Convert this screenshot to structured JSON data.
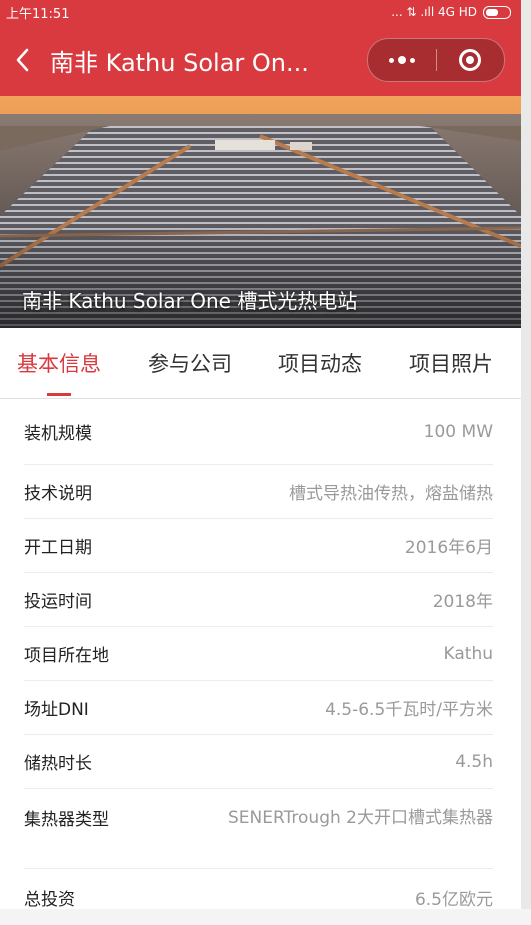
{
  "status_bar": {
    "time": "上午11:51",
    "network": "... ⇅ .ıll 4G HD"
  },
  "nav": {
    "title": "南非 Kathu Solar On...",
    "back_icon": "chevron-left-icon",
    "more_icon": "more-dots-icon",
    "close_icon": "target-circle-icon"
  },
  "hero": {
    "caption": "南非 Kathu Solar One 槽式光热电站"
  },
  "tabs": [
    {
      "label": "基本信息",
      "active": true
    },
    {
      "label": "参与公司",
      "active": false
    },
    {
      "label": "项目动态",
      "active": false
    },
    {
      "label": "项目照片",
      "active": false
    }
  ],
  "info_rows": [
    {
      "label": "装机规模",
      "value": "100 MW"
    },
    {
      "label": "技术说明",
      "value": "槽式导热油传热，熔盐储热"
    },
    {
      "label": "开工日期",
      "value": "2016年6月"
    },
    {
      "label": "投运时间",
      "value": "2018年"
    },
    {
      "label": "项目所在地",
      "value": "Kathu"
    },
    {
      "label": "场址DNI",
      "value": "4.5-6.5千瓦时/平方米"
    },
    {
      "label": "储热时长",
      "value": "4.5h"
    },
    {
      "label": "集热器类型",
      "value": "SENERTrough 2大开口槽式集热器"
    },
    {
      "label": "总投资",
      "value": "6.5亿欧元"
    }
  ],
  "colors": {
    "accent": "#d83a3f",
    "label_text": "#222222",
    "value_text": "#9a9a9a"
  }
}
